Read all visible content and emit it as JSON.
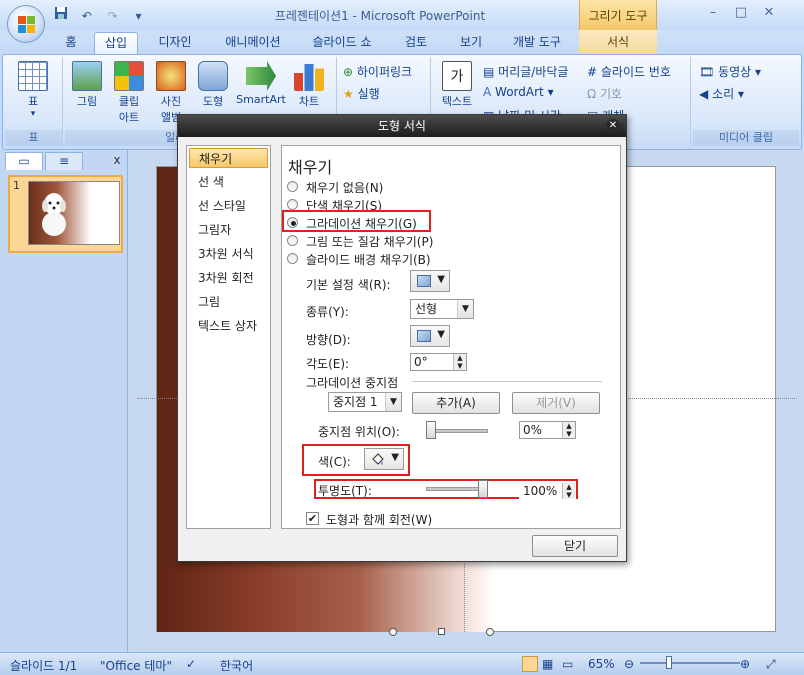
{
  "window": {
    "title": "프레젠테이션1 - Microsoft PowerPoint",
    "context_tab": "그리기 도구",
    "minimize": "–",
    "maximize": "□",
    "close": "✕"
  },
  "quick_access": {
    "save_icon": "save-icon",
    "undo_icon": "undo-icon",
    "redo_icon": "redo-icon",
    "customize": "▾"
  },
  "tabs": [
    "홈",
    "삽입",
    "디자인",
    "애니메이션",
    "슬라이드 쇼",
    "검토",
    "보기",
    "개발 도구",
    "서식"
  ],
  "active_tab": "삽입",
  "ribbon": {
    "table_group": {
      "label": "표",
      "button": "표",
      "arrow": "▾"
    },
    "illust_group": {
      "label": "일러스트레이션",
      "buttons": [
        "그림",
        "클립 아트",
        "사진 앨범",
        "도형",
        "SmartArt",
        "차트"
      ]
    },
    "link_group": {
      "hyperlink": "하이퍼링크",
      "action": "실행"
    },
    "text_group": {
      "textbox": "텍스트",
      "header_footer": "머리글/바닥글",
      "wordart": "WordArt",
      "date_time": "날짜 및 시간",
      "slide_number": "슬라이드 번호",
      "symbol": "기호",
      "object": "개체"
    },
    "media_group": {
      "label": "미디어 클립",
      "movie": "동영상",
      "sound": "소리"
    }
  },
  "panel": {
    "tab_slides": "slides-tab-icon",
    "tab_outline": "outline-tab-icon",
    "close": "x",
    "slide_number": "1"
  },
  "dialog": {
    "title": "도형 서식",
    "close": "✕",
    "nav": [
      "채우기",
      "선 색",
      "선 스타일",
      "그림자",
      "3차원 서식",
      "3차원 회전",
      "그림",
      "텍스트 상자"
    ],
    "nav_selected": 0,
    "section_title": "채우기",
    "fill_options": [
      "채우기 없음(N)",
      "단색 채우기(S)",
      "그라데이션 채우기(G)",
      "그림 또는 질감 채우기(P)",
      "슬라이드 배경 채우기(B)"
    ],
    "fill_selected": 2,
    "preset_color_label": "기본 설정 색(R):",
    "type_label": "종류(Y):",
    "type_value": "선형",
    "direction_label": "방향(D):",
    "angle_label": "각도(E):",
    "angle_value": "0°",
    "stops_header": "그라데이션 중지점",
    "stop_select": "중지점 1",
    "add_button": "추가(A)",
    "remove_button": "제거(V)",
    "stop_position_label": "중지점 위치(O):",
    "stop_position_value": "0%",
    "stop_position": 0,
    "color_label": "색(C):",
    "transparency_label": "투명도(T):",
    "transparency_value": "100%",
    "transparency": 100,
    "rotate_checkbox": "도형과 함께 회전(W)",
    "rotate_checked": true,
    "close_button": "닫기"
  },
  "statusbar": {
    "slide": "슬라이드 1/1",
    "theme": "\"Office 테마\"",
    "language": "한국어",
    "zoom": "65%",
    "zoom_out": "⊖",
    "zoom_in": "⊕"
  },
  "colors": {
    "accent_highlight": "#e0211f",
    "selected_nav": "#f6c768",
    "ribbon_blue": "#15428b",
    "slide_gradient_dark": "#5e2414"
  }
}
